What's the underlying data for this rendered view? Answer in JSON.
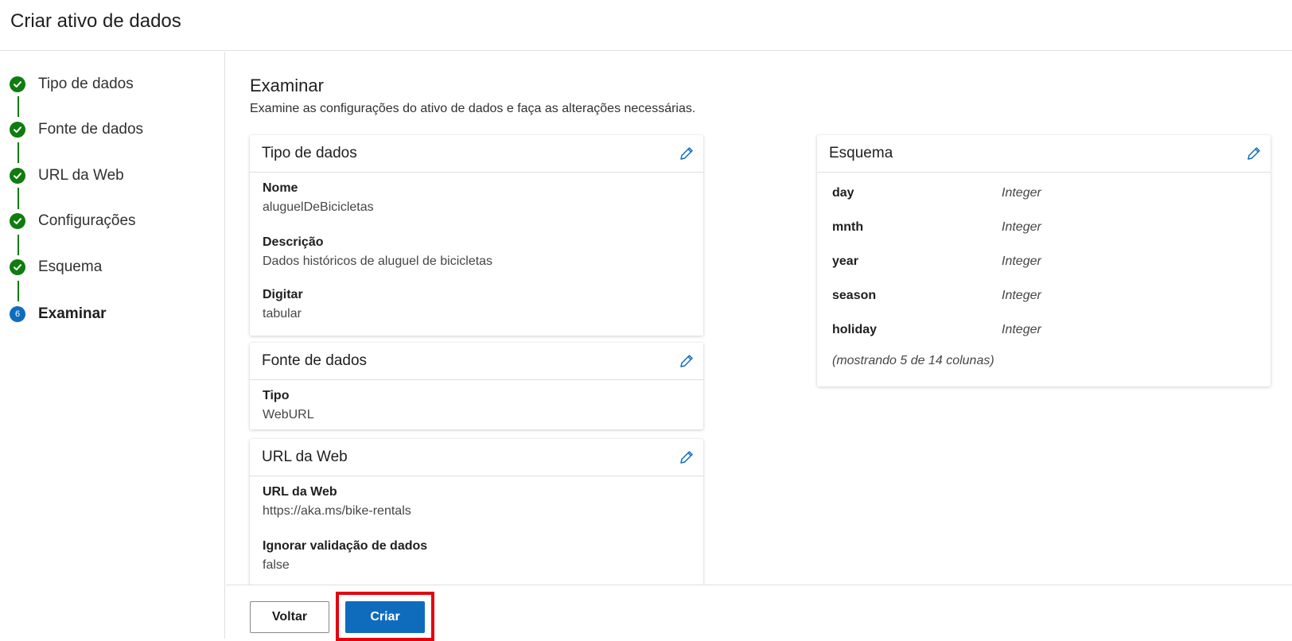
{
  "header": {
    "title": "Criar ativo de dados"
  },
  "steps": [
    {
      "label": "Tipo de dados",
      "state": "done"
    },
    {
      "label": "Fonte de dados",
      "state": "done"
    },
    {
      "label": "URL da Web",
      "state": "done"
    },
    {
      "label": "Configurações",
      "state": "done"
    },
    {
      "label": "Esquema",
      "state": "done"
    },
    {
      "label": "Examinar",
      "state": "current",
      "number": "6"
    }
  ],
  "main": {
    "title": "Examinar",
    "subtitle": "Examine as configurações do ativo de dados e faça as alterações necessárias."
  },
  "cards": {
    "data_type": {
      "title": "Tipo de dados",
      "fields": [
        {
          "label": "Nome",
          "value": "aluguelDeBicicletas"
        },
        {
          "label": "Descrição",
          "value": "Dados históricos de aluguel de bicicletas"
        },
        {
          "label": "Digitar",
          "value": "tabular"
        }
      ]
    },
    "data_source": {
      "title": "Fonte de dados",
      "fields": [
        {
          "label": "Tipo",
          "value": "WebURL"
        }
      ]
    },
    "web_url": {
      "title": "URL da Web",
      "fields": [
        {
          "label": "URL da Web",
          "value": "https://aka.ms/bike-rentals"
        },
        {
          "label": "Ignorar validação de dados",
          "value": "false"
        }
      ]
    },
    "schema": {
      "title": "Esquema",
      "columns": [
        {
          "name": "day",
          "type": "Integer"
        },
        {
          "name": "mnth",
          "type": "Integer"
        },
        {
          "name": "year",
          "type": "Integer"
        },
        {
          "name": "season",
          "type": "Integer"
        },
        {
          "name": "holiday",
          "type": "Integer"
        }
      ],
      "note": "(mostrando 5 de 14 colunas)"
    }
  },
  "footer": {
    "back_label": "Voltar",
    "create_label": "Criar"
  },
  "colors": {
    "accent": "#0f6cbd",
    "success": "#107c10",
    "highlight": "#e3000f"
  },
  "icons": {
    "edit": "pencil-icon",
    "done_step": "checkmark-circle-icon"
  }
}
